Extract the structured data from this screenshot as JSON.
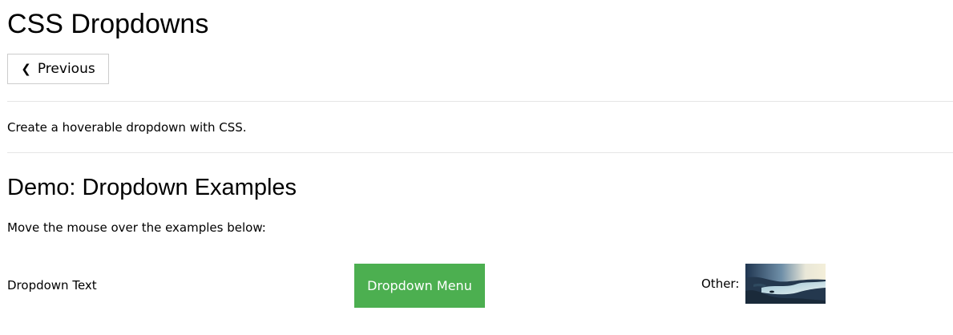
{
  "page": {
    "title": "CSS Dropdowns",
    "previous_label": "Previous",
    "intro": "Create a hoverable dropdown with CSS."
  },
  "demo": {
    "heading": "Demo: Dropdown Examples",
    "instruction": "Move the mouse over the examples below:",
    "dropdown_text": "Dropdown Text",
    "dropdown_menu_label": "Dropdown Menu",
    "other_label": "Other:"
  },
  "colors": {
    "button_green": "#4caf50",
    "divider": "#e6e6e6",
    "button_border": "#cccccc"
  },
  "icons": {
    "previous": "chevron-left-icon"
  }
}
